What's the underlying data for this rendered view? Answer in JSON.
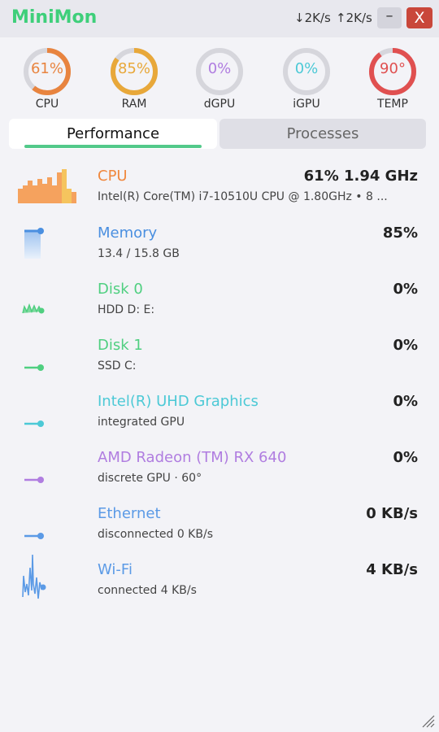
{
  "app": {
    "title": "MiniMon",
    "net_down": "↓2K/s",
    "net_up": "↑2K/s",
    "minimize_label": "–",
    "close_label": "X"
  },
  "gauges": [
    {
      "label": "CPU",
      "value": "61%",
      "percent": 61,
      "color": "#e8843f"
    },
    {
      "label": "RAM",
      "value": "85%",
      "percent": 85,
      "color": "#e8a83a"
    },
    {
      "label": "dGPU",
      "value": "0%",
      "percent": 0,
      "color": "#b07de0"
    },
    {
      "label": "iGPU",
      "value": "0%",
      "percent": 0,
      "color": "#4cc9d6"
    },
    {
      "label": "TEMP",
      "value": "90°",
      "percent": 90,
      "color": "#e05050"
    }
  ],
  "tabs": {
    "performance": "Performance",
    "processes": "Processes"
  },
  "rows": [
    {
      "name": "CPU",
      "sub": "Intel(R) Core(TM) i7-10510U CPU @ 1.80GHz  •  8 ...",
      "value": "61%  1.94 GHz",
      "color": "#f0883e"
    },
    {
      "name": "Memory",
      "sub": "13.4 / 15.8 GB",
      "value": "85%",
      "color": "#4a8fe0"
    },
    {
      "name": "Disk 0",
      "sub": "HDD  D: E:",
      "value": "0%",
      "color": "#4fcf80"
    },
    {
      "name": "Disk 1",
      "sub": "SSD  C:",
      "value": "0%",
      "color": "#4fcf80"
    },
    {
      "name": "Intel(R) UHD Graphics",
      "sub": "integrated GPU",
      "value": "0%",
      "color": "#4cc9d6"
    },
    {
      "name": "AMD Radeon (TM) RX 640",
      "sub": "discrete GPU  ·  60°",
      "value": "0%",
      "color": "#b07de0"
    },
    {
      "name": "Ethernet",
      "sub": "disconnected    0 KB/s",
      "value": "0 KB/s",
      "color": "#5b9ae6"
    },
    {
      "name": "Wi-Fi",
      "sub": "connected    4 KB/s",
      "value": "4 KB/s",
      "color": "#5b9ae6"
    }
  ]
}
